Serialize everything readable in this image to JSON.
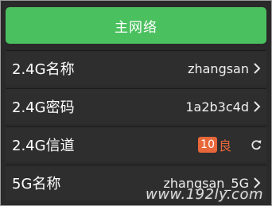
{
  "header": {
    "title": "主网络"
  },
  "rows": [
    {
      "label": "2.4G名称",
      "value": "zhangsan"
    },
    {
      "label": "2.4G密码",
      "value": "1a2b3c4d"
    },
    {
      "label": "2.4G信道",
      "channel": "10",
      "quality": "良"
    },
    {
      "label": "5G名称",
      "value": "zhangsan_5G"
    }
  ],
  "watermark": "www.192ly.com",
  "icons": {
    "chevron": "chevron-right-icon",
    "refresh": "refresh-icon"
  },
  "colors": {
    "header": "#4bc05f",
    "row_bg": "#2e2e2e",
    "badge": "#e8673a"
  }
}
